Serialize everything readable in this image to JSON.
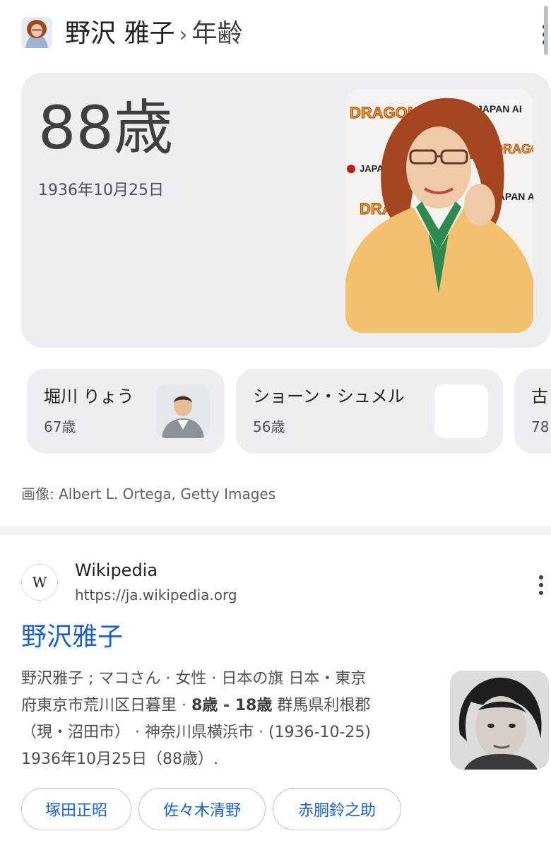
{
  "header": {
    "name": "野沢 雅子",
    "separator": "›",
    "attribute": "年齢"
  },
  "age_card": {
    "age": "88歳",
    "birth_date": "1936年10月25日"
  },
  "related_people": [
    {
      "name": "堀川 りょう",
      "age": "67歳"
    },
    {
      "name": "ショーン・シュメル",
      "age": "56歳"
    },
    {
      "name": "古",
      "age": "78"
    }
  ],
  "image_credit": "画像: Albert L. Ortega, Getty Images",
  "result": {
    "favicon_letter": "W",
    "site_name": "Wikipedia",
    "url": "https://ja.wikipedia.org",
    "title": "野沢雅子",
    "snippet": {
      "line1": "野沢雅子 ; マコさん · 女性 · 日本の旗 日本・東京",
      "line2_pre": "府東京市荒川区日暮里 · ",
      "line2_bold1": "8歳",
      "line2_mid": " - ",
      "line2_bold2": "18歳",
      "line2_post": " 群馬県利根郡",
      "line3": "（現・沼田市） · 神奈川県横浜市 · (1936-10-25)",
      "line4": "1936年10月25日（88歳）."
    }
  },
  "related_chips": [
    "塚田正昭",
    "佐々木清野",
    "赤胴鈴之助"
  ],
  "icons": {
    "header_menu": "more-vert-icon",
    "result_menu": "more-vert-icon",
    "favicon": "wikipedia-icon"
  },
  "colors": {
    "link": "#1a5fd1",
    "card_bg": "#edeef1"
  }
}
